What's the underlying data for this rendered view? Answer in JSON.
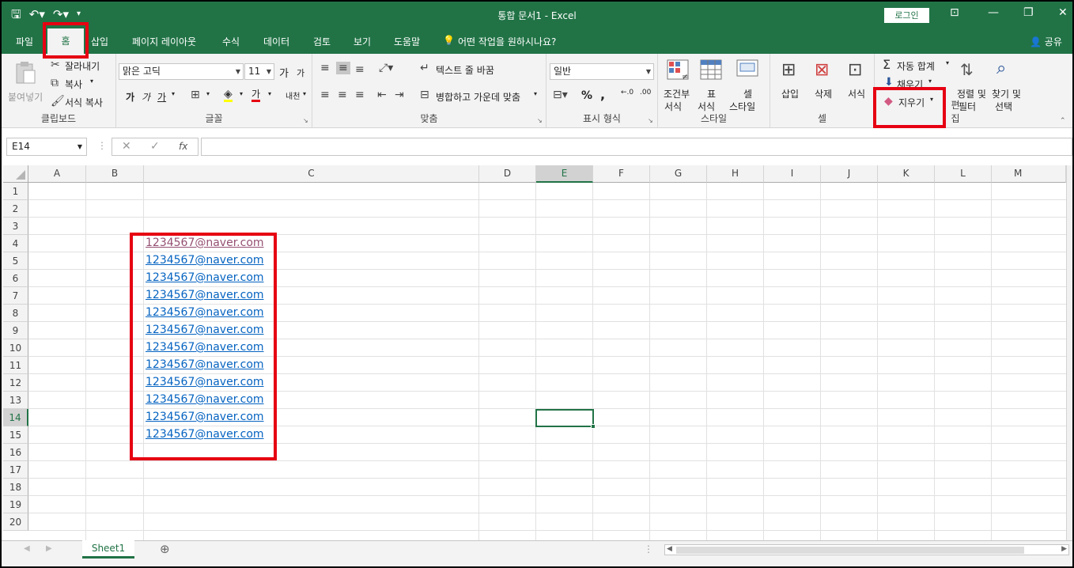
{
  "window": {
    "title": "통합 문서1  -  Excel",
    "login": "로그인"
  },
  "tabs": [
    "파일",
    "홈",
    "삽입",
    "페이지 레이아웃",
    "수식",
    "데이터",
    "검토",
    "보기",
    "도움말"
  ],
  "tell_me": "어떤 작업을 원하시나요?",
  "share": "공유",
  "ribbon": {
    "clipboard": {
      "label": "클립보드",
      "paste": "붙여넣기",
      "cut": "잘라내기",
      "copy": "복사",
      "format_painter": "서식 복사"
    },
    "font": {
      "label": "글꼴",
      "font_name": "맑은 고딕",
      "font_size": "11",
      "grow": "가",
      "shrink": "가",
      "bold": "가",
      "italic": "가",
      "underline": "가",
      "font_color": "가",
      "phonetic": "내천"
    },
    "alignment": {
      "label": "맞춤",
      "wrap": "텍스트 줄 바꿈",
      "merge": "병합하고 가운데 맞춤"
    },
    "number": {
      "label": "표시 형식",
      "format": "일반",
      "percent": "%",
      "comma": ","
    },
    "styles": {
      "label": "스타일",
      "conditional_1": "조건부",
      "conditional_2": "서식",
      "table_1": "표",
      "table_2": "서식",
      "cell_1": "셀",
      "cell_2": "스타일"
    },
    "cells": {
      "label": "셀",
      "insert": "삽입",
      "delete": "삭제",
      "format": "서식"
    },
    "editing": {
      "label": "편집",
      "autosum": "자동 합계",
      "fill": "채우기",
      "clear": "지우기",
      "sort_1": "정렬 및",
      "sort_2": "필터",
      "find_1": "찾기 및",
      "find_2": "선택"
    }
  },
  "formula_bar": {
    "name_box": "E14",
    "fx": "fx",
    "value": ""
  },
  "columns": [
    "A",
    "B",
    "C",
    "D",
    "E",
    "F",
    "G",
    "H",
    "I",
    "J",
    "K",
    "L",
    "M"
  ],
  "rows": [
    "1",
    "2",
    "3",
    "4",
    "5",
    "6",
    "7",
    "8",
    "9",
    "10",
    "11",
    "12",
    "13",
    "14",
    "15",
    "16",
    "17",
    "18",
    "19",
    "20"
  ],
  "selected_cell": "E14",
  "cells_c": [
    "1234567@naver.com",
    "1234567@naver.com",
    "1234567@naver.com",
    "1234567@naver.com",
    "1234567@naver.com",
    "1234567@naver.com",
    "1234567@naver.com",
    "1234567@naver.com",
    "1234567@naver.com",
    "1234567@naver.com",
    "1234567@naver.com",
    "1234567@naver.com"
  ],
  "sheet_tab": "Sheet1",
  "colors": {
    "accent": "#217346",
    "hyperlink": "#0563c1",
    "visited_link": "#954f72",
    "highlight": "#e60012"
  }
}
